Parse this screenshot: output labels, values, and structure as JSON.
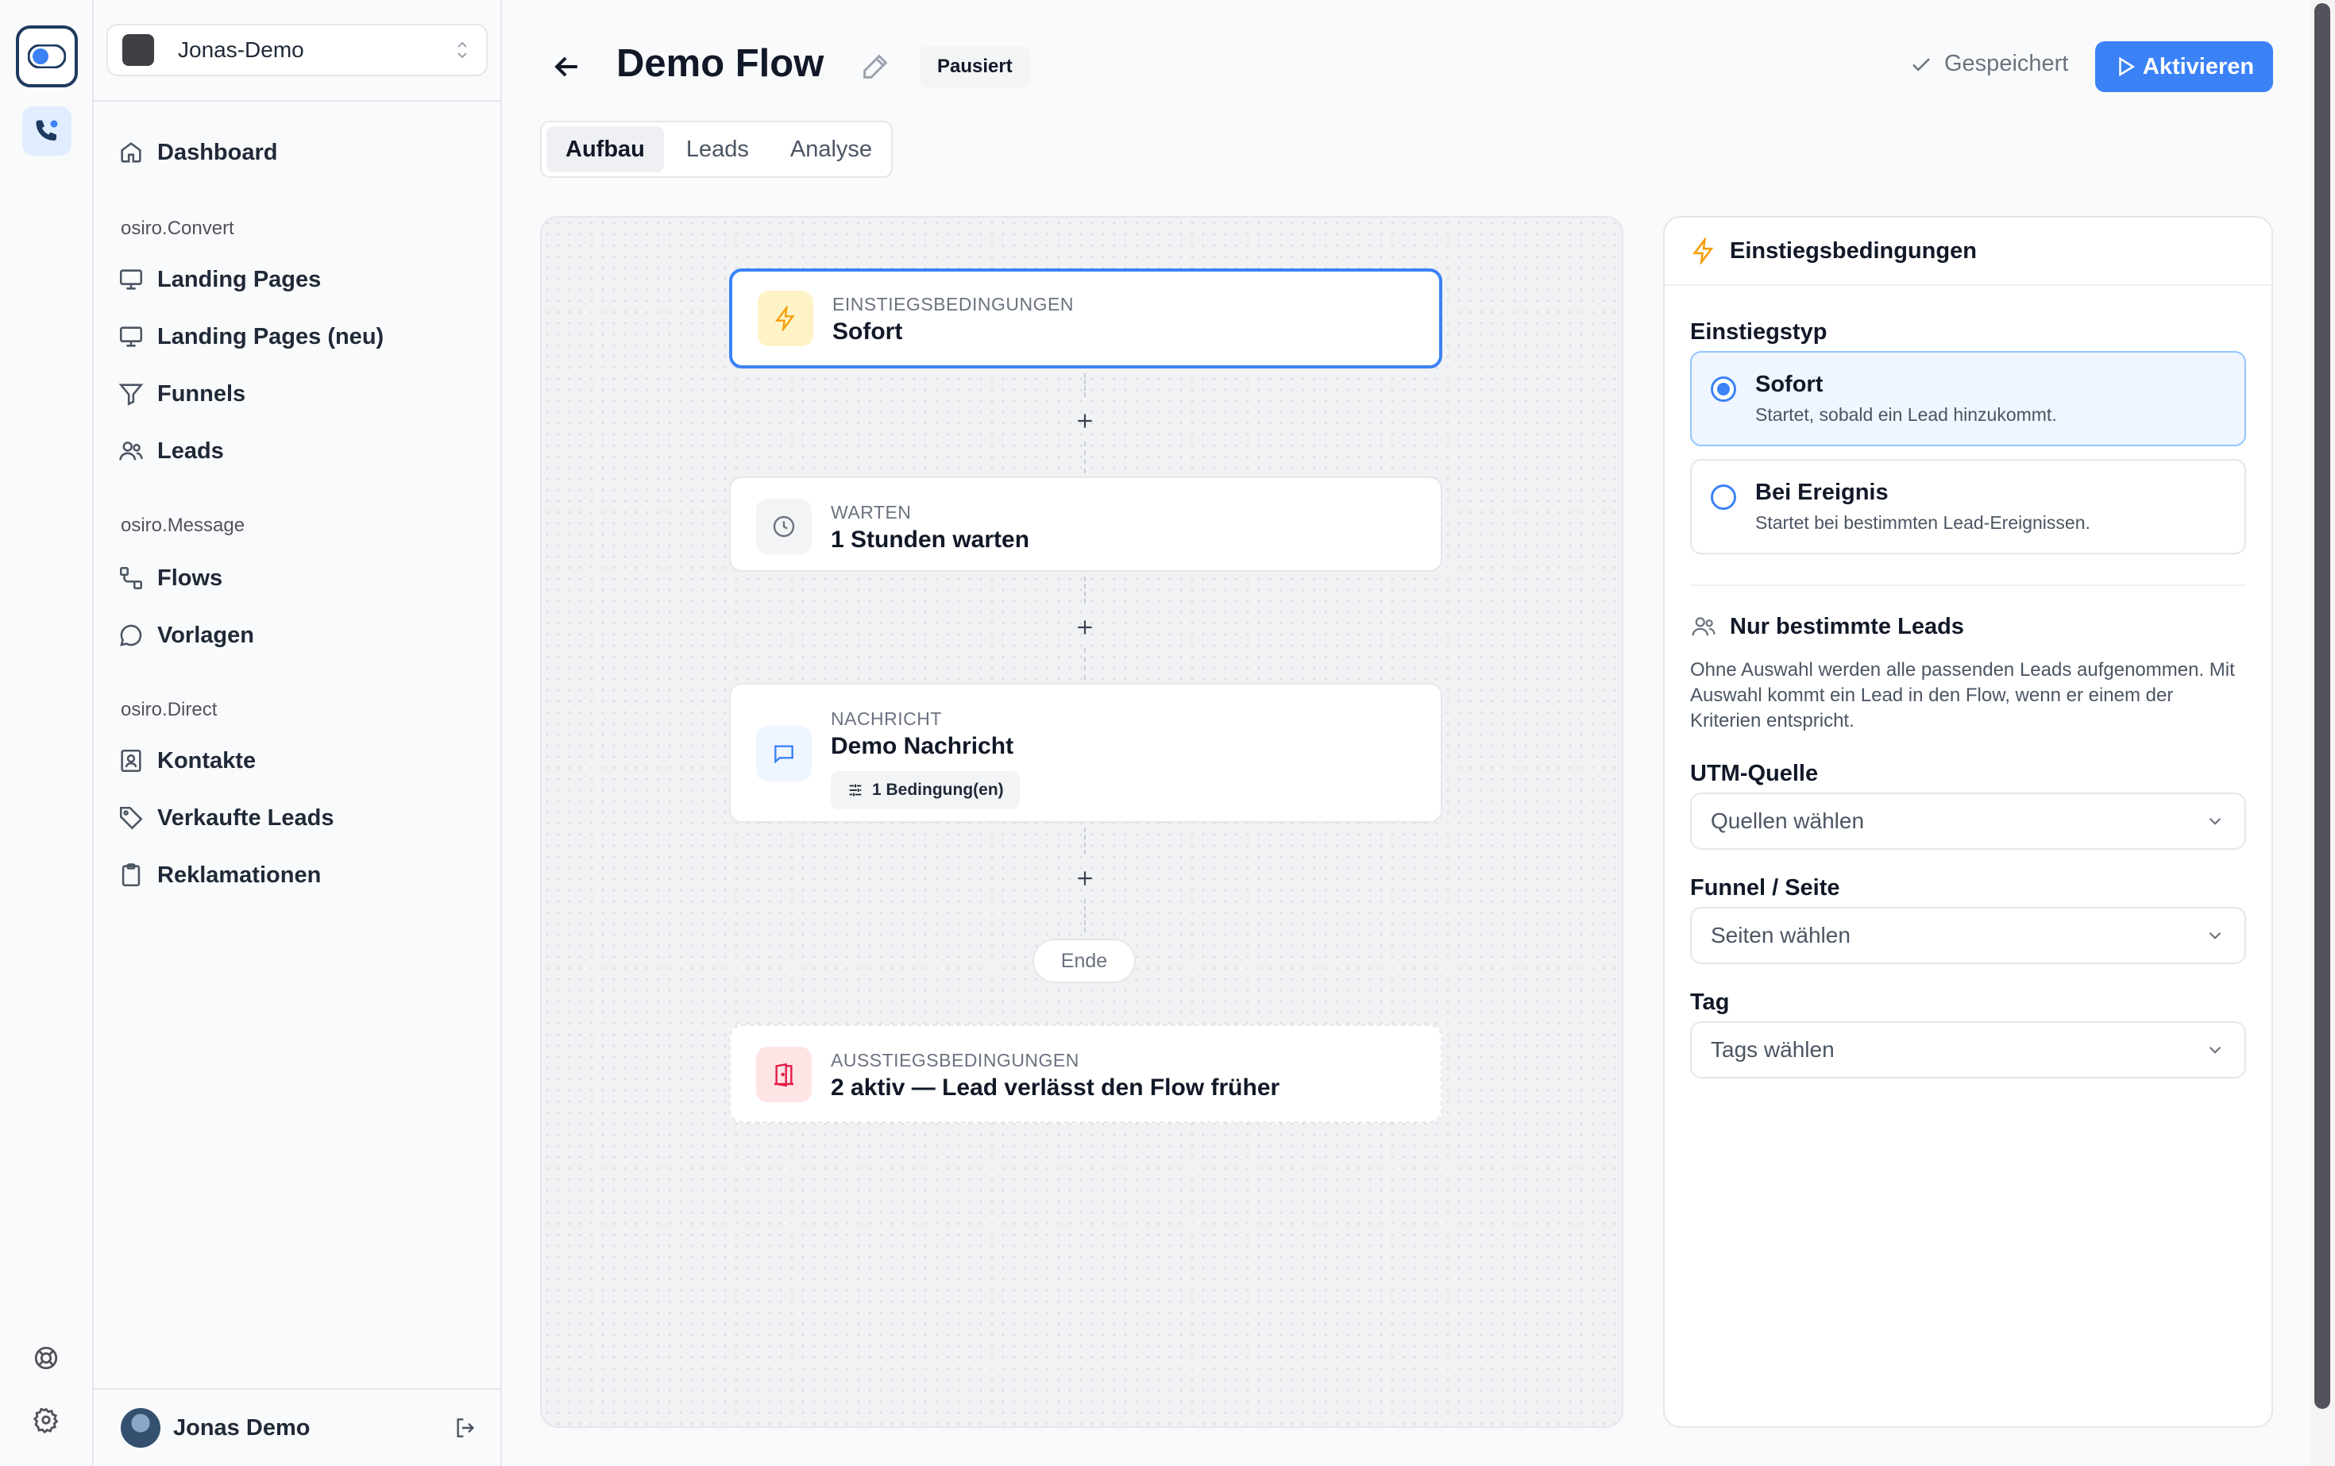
{
  "colors": {
    "accent": "#3b82f6",
    "lightning": "#f59e0b",
    "exit": "#e11d48",
    "wait_icon_bg": "#f3f4f6",
    "message_icon_bg": "#eff6ff"
  },
  "rail": {
    "items": [
      {
        "icon": "app-logo-icon"
      },
      {
        "icon": "phone-icon"
      },
      {
        "icon": "help-lifebuoy-icon"
      },
      {
        "icon": "settings-gear-icon"
      }
    ]
  },
  "sidebar": {
    "workspace": "Jonas-Demo",
    "dashboard": "Dashboard",
    "sections": [
      {
        "title": "osiro.Convert",
        "items": [
          "Landing Pages",
          "Landing Pages (neu)",
          "Funnels",
          "Leads"
        ]
      },
      {
        "title": "osiro.Message",
        "items": [
          "Flows",
          "Vorlagen"
        ]
      },
      {
        "title": "osiro.Direct",
        "items": [
          "Kontakte",
          "Verkaufte Leads",
          "Reklamationen"
        ]
      }
    ],
    "user": "Jonas Demo"
  },
  "header": {
    "title": "Demo Flow",
    "status": "Pausiert",
    "saved": "Gespeichert",
    "activate": "Aktivieren"
  },
  "tabs": [
    "Aufbau",
    "Leads",
    "Analyse"
  ],
  "active_tab": "Aufbau",
  "flow": {
    "nodes": [
      {
        "kicker": "EINSTIEGSBEDINGUNGEN",
        "title": "Sofort",
        "icon": "lightning-icon"
      },
      {
        "kicker": "WARTEN",
        "title": "1 Stunden warten",
        "icon": "clock-icon"
      },
      {
        "kicker": "NACHRICHT",
        "title": "Demo Nachricht",
        "icon": "message-icon",
        "chip": "1 Bedingung(en)"
      }
    ],
    "plus": "+",
    "end": "Ende",
    "exit": {
      "kicker": "AUSSTIEGSBEDINGUNGEN",
      "title": "2 aktiv — Lead verlässt den Flow früher",
      "icon": "door-exit-icon"
    }
  },
  "panel": {
    "title": "Einstiegsbedingungen",
    "entry_type_label": "Einstiegstyp",
    "options": [
      {
        "title": "Sofort",
        "desc": "Startet, sobald ein Lead hinzukommt.",
        "selected": true
      },
      {
        "title": "Bei Ereignis",
        "desc": "Startet bei bestimmten Lead-Ereignissen.",
        "selected": false
      }
    ],
    "only_leads_title": "Nur bestimmte Leads",
    "help": "Ohne Auswahl werden alle passenden Leads aufgenommen. Mit Auswahl kommt ein Lead in den Flow, wenn er einem der Kriterien entspricht.",
    "filters": [
      {
        "label": "UTM-Quelle",
        "placeholder": "Quellen wählen"
      },
      {
        "label": "Funnel / Seite",
        "placeholder": "Seiten wählen"
      },
      {
        "label": "Tag",
        "placeholder": "Tags wählen"
      }
    ]
  }
}
